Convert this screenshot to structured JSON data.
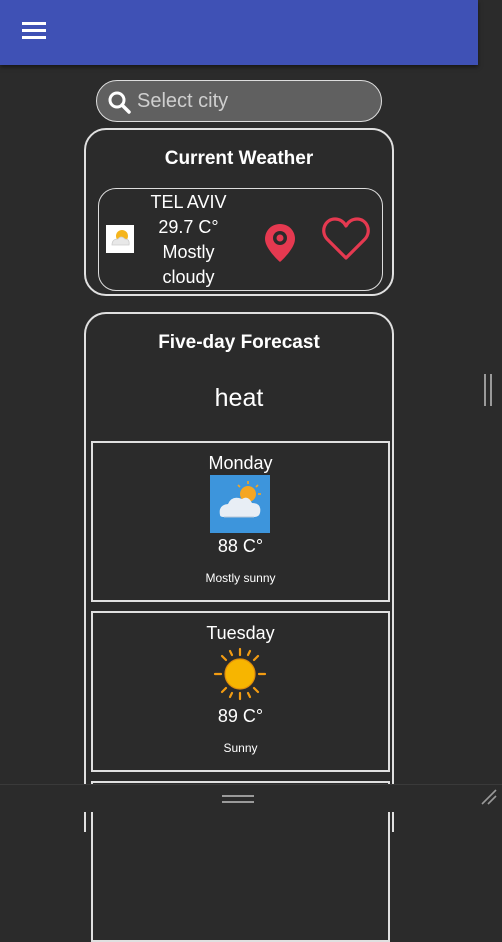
{
  "header": {
    "menu_icon": "hamburger-menu-icon",
    "color": "#3f51b5"
  },
  "search": {
    "placeholder": "Select city",
    "icon": "search-icon"
  },
  "current_weather": {
    "title": "Current Weather",
    "city": "TEL AVIV",
    "temperature": "29.7 C°",
    "condition_line1": "Mostly",
    "condition_line2": "cloudy",
    "location_icon": "location-pin-icon",
    "favorite_icon": "heart-icon",
    "accent": "#e53950"
  },
  "forecast": {
    "title": "Five-day Forecast",
    "subtitle": "heat",
    "days": [
      {
        "name": "Monday",
        "temp": "88 C°",
        "desc": "Mostly sunny",
        "icon": "cloud-sun-icon"
      },
      {
        "name": "Tuesday",
        "temp": "89 C°",
        "desc": "Sunny",
        "icon": "sun-icon"
      }
    ]
  }
}
